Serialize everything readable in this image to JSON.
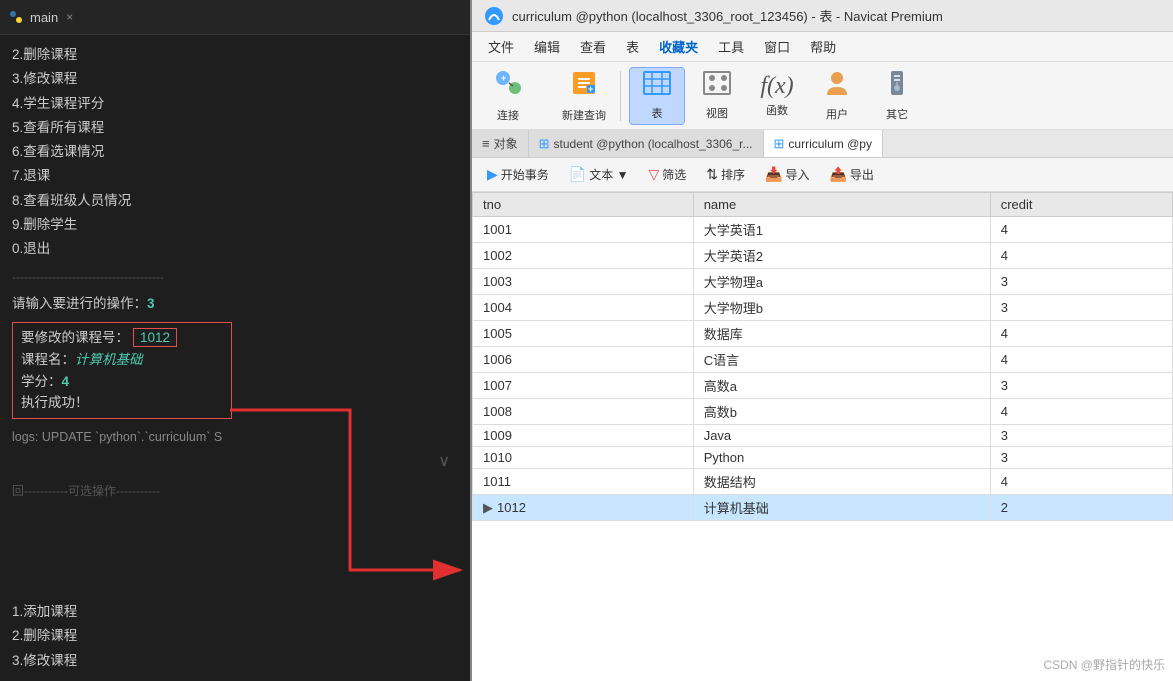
{
  "leftPanel": {
    "tabTitle": "main",
    "menuItems": [
      "2.删除课程",
      "3.修改课程",
      "4.学生课程评分",
      "5.查看所有课程",
      "6.查看选课情况",
      "7.退课",
      "8.查看班级人员情况",
      "9.删除学生",
      "0.退出"
    ],
    "separator1": "--------------------------------------",
    "promptLabel": "请输入要进行的操作：",
    "promptValue": "3",
    "inputBox": {
      "courseNoLabel": "要修改的课程号：",
      "courseNoValue": "1012",
      "courseNameLabel": "课程名：",
      "courseNameValue": "计算机基础",
      "creditLabel": "学分：",
      "creditValue": "4",
      "successMsg": "执行成功！"
    },
    "logText": "logs: UPDATE `python`.`curriculum` S",
    "scrollIndicator": "∨",
    "separator2": "回-----------可选操作-----------",
    "bottomMenu": [
      "1.添加课程",
      "2.删除课程",
      "3.修改课程"
    ]
  },
  "rightPanel": {
    "titlebar": "curriculum @python (localhost_3306_root_123456) - 表 - Navicat Premium",
    "menubar": [
      "文件",
      "编辑",
      "查看",
      "表",
      "收藏夹",
      "工具",
      "窗口",
      "帮助"
    ],
    "activeMenu": "收藏夹",
    "toolbar": [
      {
        "id": "connect",
        "label": "连接",
        "icon": "🔌"
      },
      {
        "id": "new-query",
        "label": "新建查询",
        "icon": "📋"
      },
      {
        "id": "table",
        "label": "表",
        "icon": "⊞"
      },
      {
        "id": "view",
        "label": "视图",
        "icon": "👁"
      },
      {
        "id": "function",
        "label": "函数",
        "icon": "ƒ"
      },
      {
        "id": "user",
        "label": "用户",
        "icon": "👤"
      },
      {
        "id": "other",
        "label": "其它",
        "icon": "🔧"
      }
    ],
    "tabs": [
      {
        "id": "object",
        "label": "对象",
        "icon": "≡"
      },
      {
        "id": "student",
        "label": "student @python (localhost_3306_r...",
        "icon": "⊞",
        "active": false
      },
      {
        "id": "curriculum",
        "label": "curriculum @py",
        "icon": "⊞",
        "active": true
      }
    ],
    "tableToolbar": [
      {
        "id": "begin-tx",
        "label": "开始事务",
        "icon": "▷"
      },
      {
        "id": "text",
        "label": "文本 ▼",
        "icon": "T"
      },
      {
        "id": "filter",
        "label": "筛选",
        "icon": "▽"
      },
      {
        "id": "sort",
        "label": "排序",
        "icon": "↕"
      },
      {
        "id": "import",
        "label": "导入",
        "icon": "→"
      },
      {
        "id": "export",
        "label": "导出",
        "icon": "←"
      }
    ],
    "tableHeaders": [
      "tno",
      "name",
      "credit"
    ],
    "tableData": [
      {
        "tno": "1001",
        "name": "大学英语1",
        "credit": "4"
      },
      {
        "tno": "1002",
        "name": "大学英语2",
        "credit": "4"
      },
      {
        "tno": "1003",
        "name": "大学物理a",
        "credit": "3"
      },
      {
        "tno": "1004",
        "name": "大学物理b",
        "credit": "3"
      },
      {
        "tno": "1005",
        "name": "数据库",
        "credit": "4"
      },
      {
        "tno": "1006",
        "name": "C语言",
        "credit": "4"
      },
      {
        "tno": "1007",
        "name": "高数a",
        "credit": "3"
      },
      {
        "tno": "1008",
        "name": "高数b",
        "credit": "4"
      },
      {
        "tno": "1009",
        "name": "Java",
        "credit": "3"
      },
      {
        "tno": "1010",
        "name": "Python",
        "credit": "3"
      },
      {
        "tno": "1011",
        "name": "数据结构",
        "credit": "4"
      },
      {
        "tno": "1012",
        "name": "计算机基础",
        "credit": "2",
        "highlighted": true
      }
    ],
    "watermark": "CSDN @野指针的快乐"
  }
}
